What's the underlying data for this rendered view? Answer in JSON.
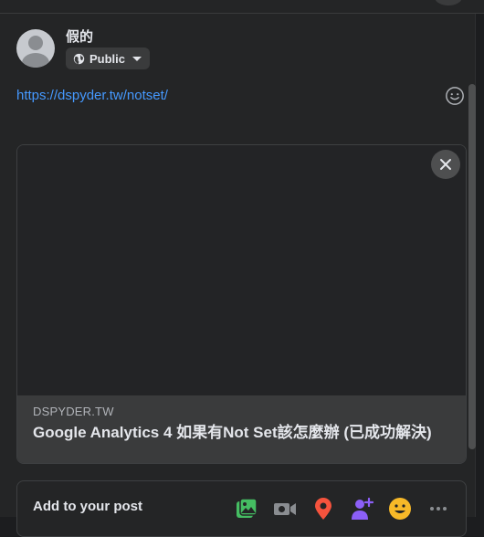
{
  "author": {
    "name": "假的"
  },
  "audience": {
    "label": "Public",
    "icon": "globe-icon"
  },
  "post": {
    "link": "https://dspyder.tw/notset/"
  },
  "preview": {
    "domain": "DSPYDER.TW",
    "title": "Google Analytics 4 如果有Not Set該怎麼辦 (已成功解決)"
  },
  "add_to_post": {
    "label": "Add to your post",
    "tools": [
      "photo-video-icon",
      "live-video-icon",
      "check-in-icon",
      "tag-people-icon",
      "feeling-icon",
      "more-icon"
    ]
  },
  "colors": {
    "background": "#242526",
    "link": "#4599ff",
    "photo": "#45bd62",
    "location": "#f5533d",
    "tag": "#8c5ff7",
    "feeling": "#f7b928"
  }
}
